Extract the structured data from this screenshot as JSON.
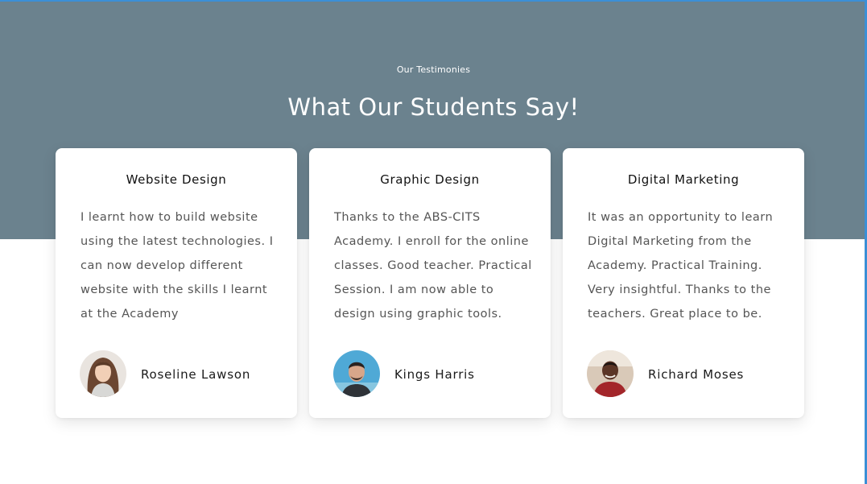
{
  "section": {
    "eyebrow": "Our Testimonies",
    "title": "What Our Students Say!"
  },
  "testimonials": [
    {
      "course": "Website Design",
      "text": "I learnt how to build website using the latest technologies. I can now develop different website with the skills I learnt at the Academy",
      "author": "Roseline Lawson"
    },
    {
      "course": "Graphic Design",
      "text": "Thanks to the ABS-CITS Academy. I enroll for the online classes. Good teacher. Practical Session. I am now able to design using graphic tools.",
      "author": "Kings Harris"
    },
    {
      "course": "Digital Marketing",
      "text": "It was an opportunity to learn Digital Marketing from the Academy. Practical Training. Very insightful. Thanks to the teachers. Great place to be.",
      "author": "Richard Moses"
    }
  ],
  "colors": {
    "hero_background": "#6b828e",
    "card_background": "#ffffff",
    "frame_accent": "#3b8fd6"
  }
}
